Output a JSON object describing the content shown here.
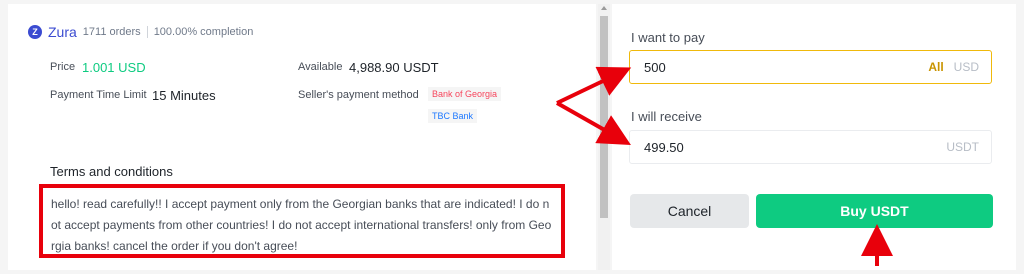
{
  "merchant": {
    "avatar_letter": "Z",
    "name": "Zura",
    "orders": "1711 orders",
    "completion": "100.00% completion"
  },
  "ad_info": {
    "price_label": "Price",
    "price_value": "1.001 USD",
    "available_label": "Available",
    "available_value": "4,988.90 USDT",
    "time_limit_label": "Payment Time Limit",
    "time_limit_value": "15 Minutes",
    "payment_method_label": "Seller's payment method",
    "payment_methods": [
      "Bank of Georgia",
      "TBC Bank"
    ]
  },
  "terms": {
    "title": "Terms and conditions",
    "text": "hello! read carefully!! I accept payment only from the Georgian banks that are indicated! I do not accept payments from other countries! I do not accept international transfers! only from Georgia banks! cancel the order if you don't agree!"
  },
  "order_form": {
    "pay_label": "I want to pay",
    "pay_value": "500",
    "pay_all": "All",
    "pay_unit": "USD",
    "receive_label": "I will receive",
    "receive_value": "499.50",
    "receive_unit": "USDT",
    "cancel_label": "Cancel",
    "buy_label": "Buy USDT"
  },
  "colors": {
    "accent_green": "#0ecb81",
    "accent_gold": "#f0b90b",
    "annotation_red": "#e8000b",
    "merchant_blue": "#3b4bd1"
  }
}
